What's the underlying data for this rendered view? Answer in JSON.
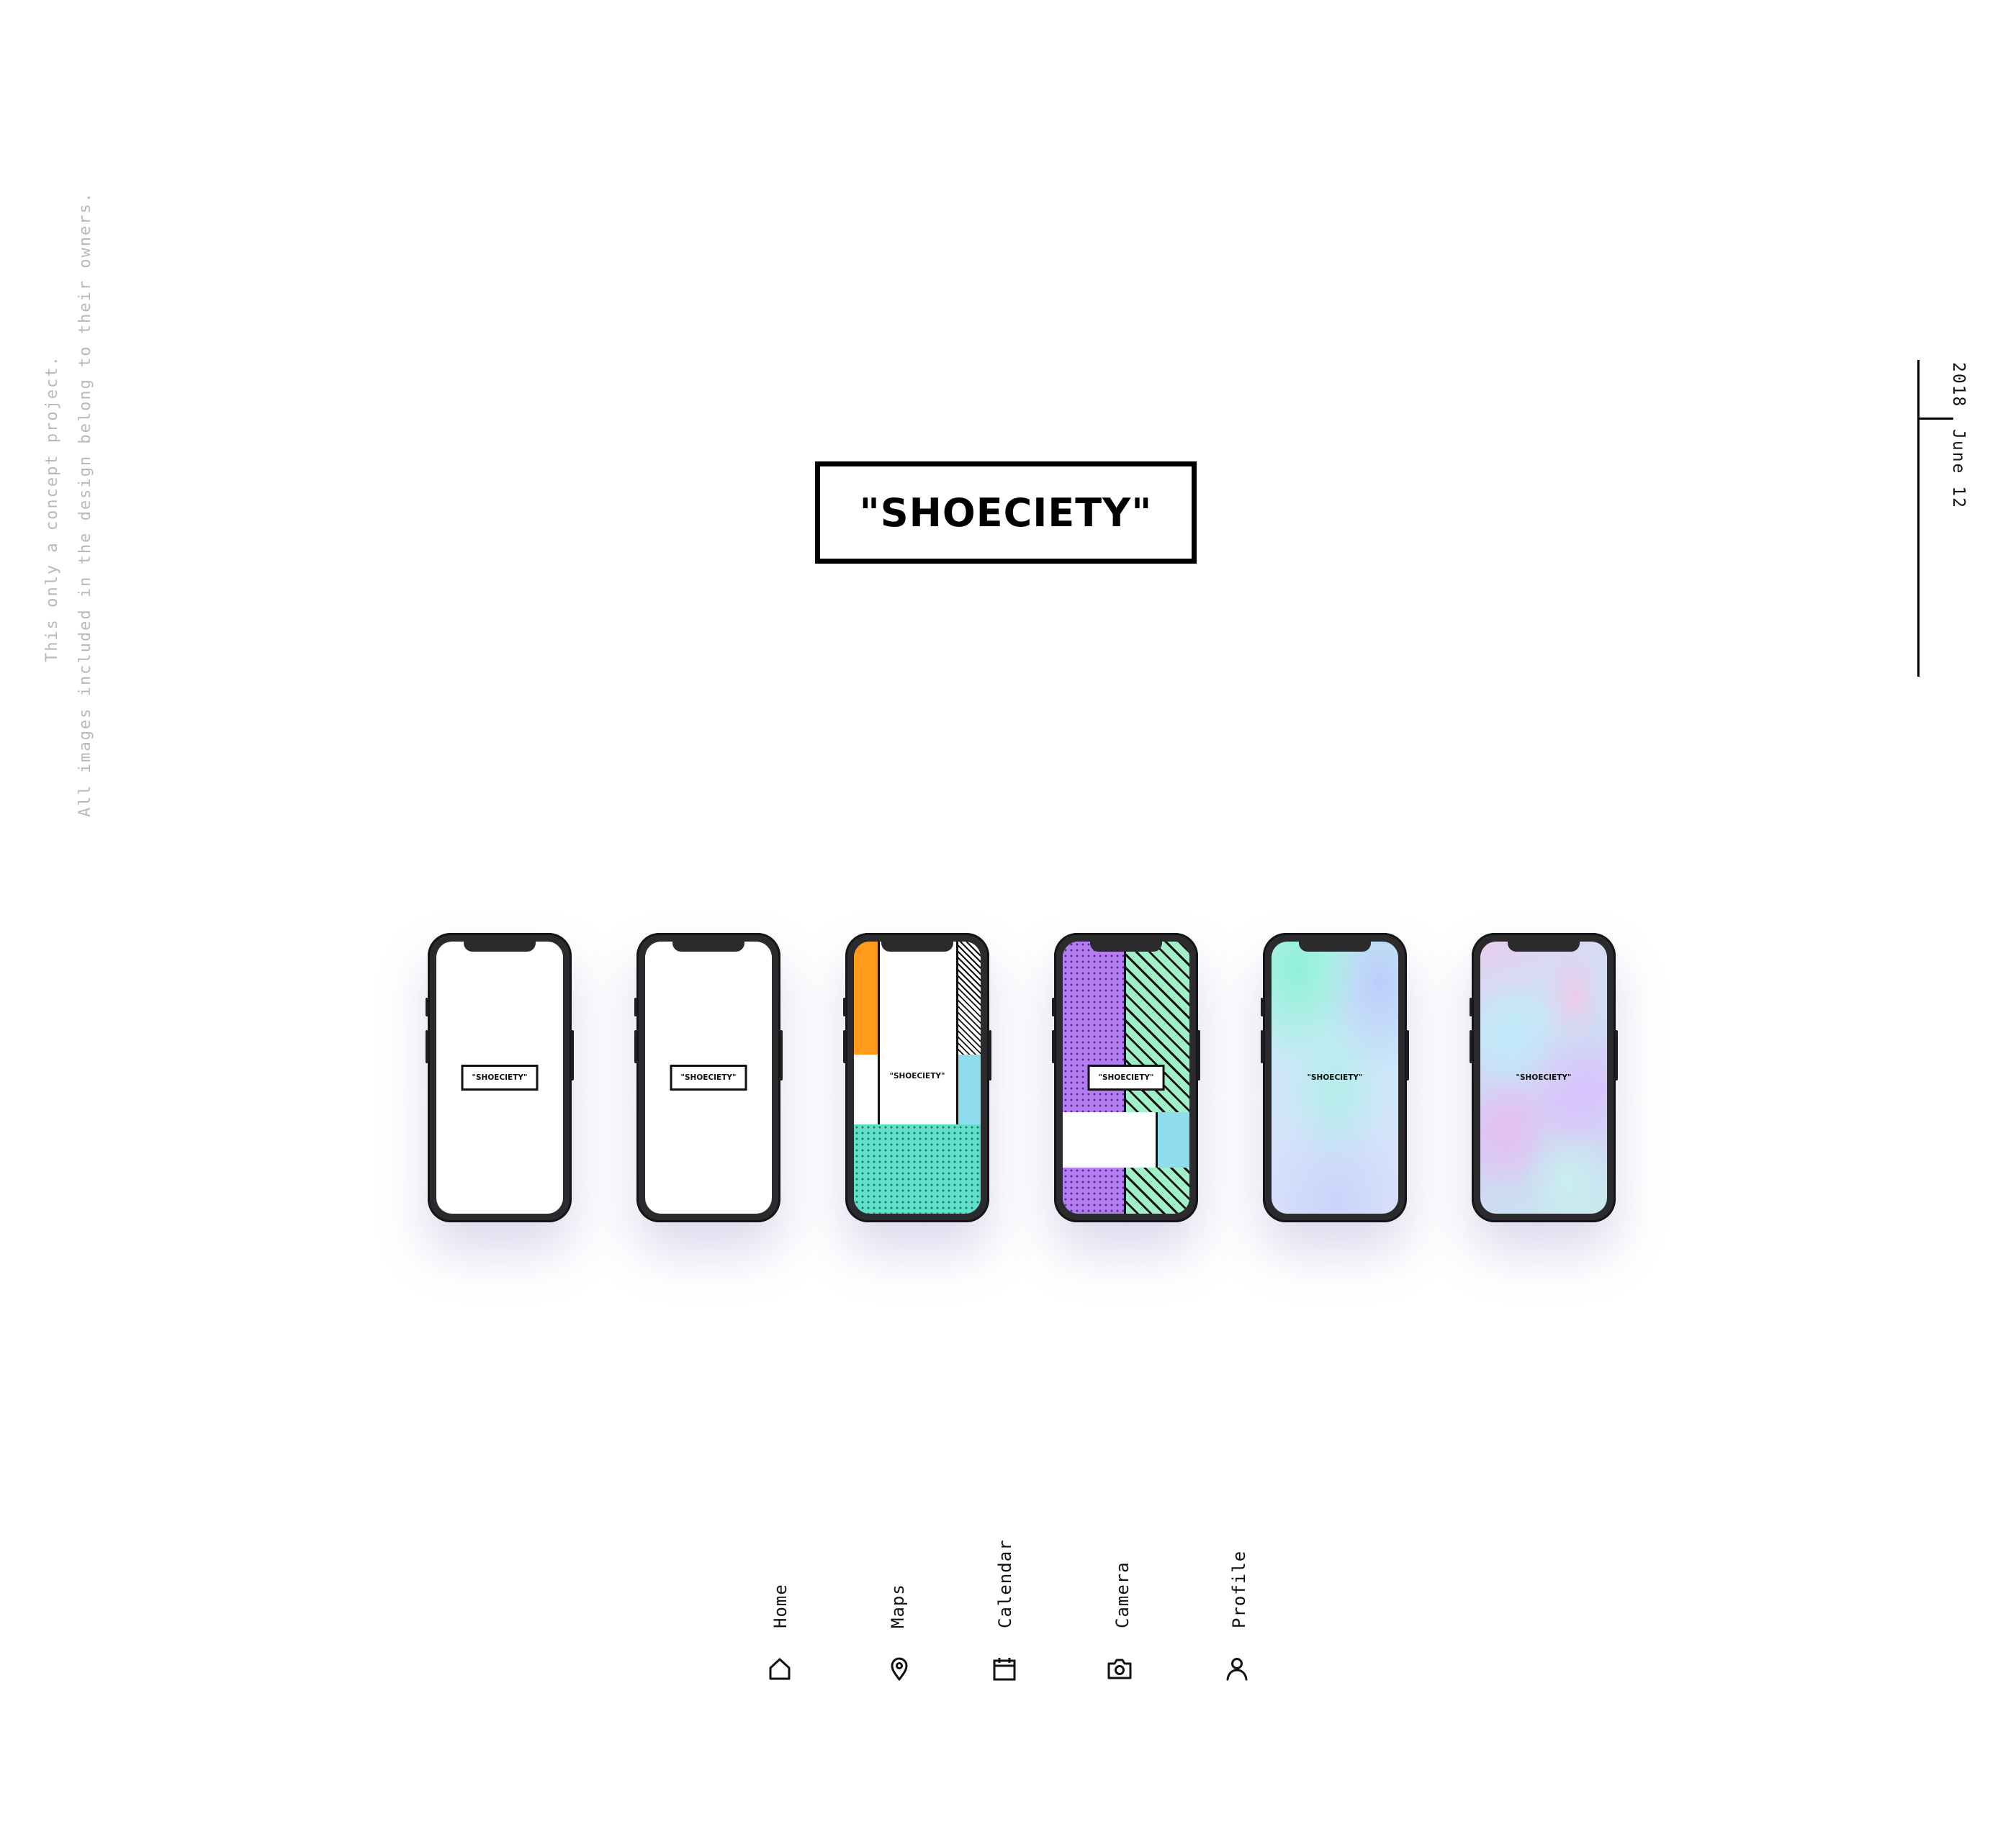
{
  "disclaimer": {
    "line1": "This only a concept project.",
    "line2": "All images included in the design belong to their owners."
  },
  "date": {
    "year": "2018",
    "day": "June 12"
  },
  "brand": {
    "title": "\"SHOECIETY\""
  },
  "phones": [
    {
      "style": "diagonal-lines",
      "logo": "\"SHOECIETY\""
    },
    {
      "style": "dots",
      "logo": "\"SHOECIETY\""
    },
    {
      "style": "color-blocks",
      "logo": "\"SHOECIETY\""
    },
    {
      "style": "purple-green-blocks",
      "logo": "\"SHOECIETY\""
    },
    {
      "style": "holographic-soft",
      "logo": "\"SHOECIETY\""
    },
    {
      "style": "holographic-swirl",
      "logo": "\"SHOECIETY\""
    }
  ],
  "colors": {
    "orange": "#ff9a1a",
    "cyan": "#8fdcef",
    "teal": "#5ee0c8",
    "purple": "#b37cf2",
    "mint": "#9ff0c8"
  },
  "nav": [
    {
      "label": "Home",
      "icon": "home-icon"
    },
    {
      "label": "Maps",
      "icon": "map-pin-icon"
    },
    {
      "label": "Calendar",
      "icon": "calendar-icon"
    },
    {
      "label": "Camera",
      "icon": "camera-icon"
    },
    {
      "label": "Profile",
      "icon": "profile-icon"
    }
  ]
}
